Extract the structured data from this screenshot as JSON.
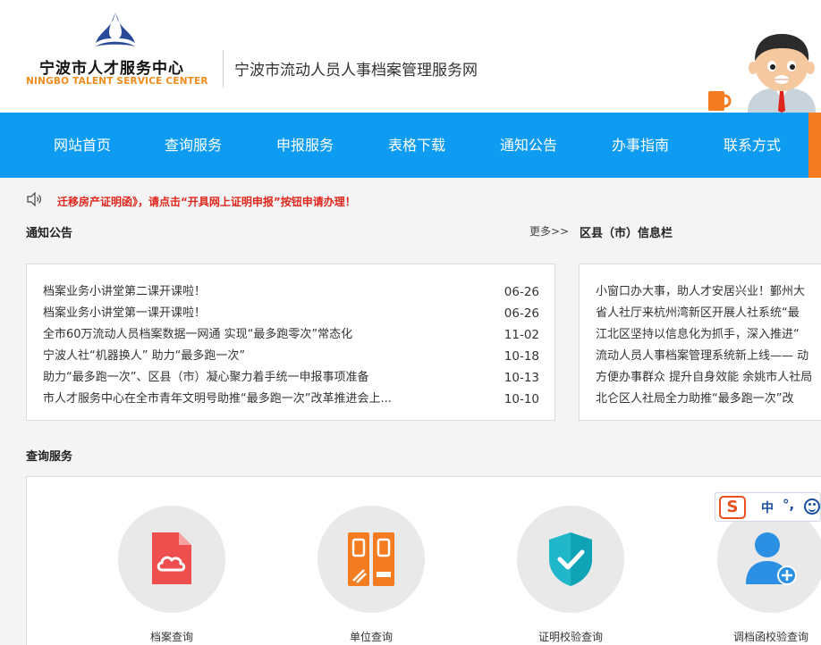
{
  "header": {
    "logo_cn": "宁波市人才服务中心",
    "logo_en": "NINGBO TALENT SERVICE CENTER",
    "site_title": "宁波市流动人员人事档案管理服务网",
    "logo_icon": "tri-arc-logo-icon",
    "mascot_icon": "cartoon-man-mascot"
  },
  "nav": {
    "items": [
      {
        "label": "网站首页"
      },
      {
        "label": "查询服务"
      },
      {
        "label": "申报服务"
      },
      {
        "label": "表格下载"
      },
      {
        "label": "通知公告"
      },
      {
        "label": "办事指南"
      },
      {
        "label": "联系方式"
      }
    ]
  },
  "marquee": {
    "icon": "speaker-icon",
    "text": "迁移房产证明函》，请点击“开具网上证明申报”按钮申请办理！"
  },
  "notices": {
    "title": "通知公告",
    "more": "更多>>",
    "items": [
      {
        "title": "档案业务小讲堂第二课开课啦！",
        "date": "06-26"
      },
      {
        "title": "档案业务小讲堂第一课开课啦！",
        "date": "06-26"
      },
      {
        "title": "全市60万流动人员档案数据一网通 实现“最多跑零次”常态化",
        "date": "11-02"
      },
      {
        "title": "宁波人社“机器换人” 助力“最多跑一次”",
        "date": "10-18"
      },
      {
        "title": "助力“最多跑一次”、区县（市）凝心聚力着手统一申报事项准备",
        "date": "10-13"
      },
      {
        "title": "市人才服务中心在全市青年文明号助推“最多跑一次”改革推进会上...",
        "date": "10-10"
      }
    ]
  },
  "county": {
    "title": "区县（市）信息栏",
    "items": [
      {
        "title": "小窗口办大事，助人才安居兴业！鄞州大"
      },
      {
        "title": "省人社厅来杭州湾新区开展人社系统“最"
      },
      {
        "title": "江北区坚持以信息化为抓手，深入推进“"
      },
      {
        "title": "流动人员人事档案管理系统新上线—— 动"
      },
      {
        "title": "方便办事群众 提升自身效能 余姚市人社局"
      },
      {
        "title": "北仑区人社局全力助推“最多跑一次”改"
      }
    ]
  },
  "services": {
    "title": "查询服务",
    "items": [
      {
        "label": "档案查询",
        "icon": "cloud-document-icon",
        "color": "#ee4e4e"
      },
      {
        "label": "单位查询",
        "icon": "binder-folders-icon",
        "color": "#f47b20"
      },
      {
        "label": "证明校验查询",
        "icon": "shield-check-icon",
        "color": "#1fb7c9"
      },
      {
        "label": "调档函校验查询",
        "icon": "user-add-icon",
        "color": "#2b8fe3"
      }
    ]
  },
  "ime": {
    "logo": "S",
    "lang": "中",
    "punct": "°,",
    "face_icon": "smiley-icon"
  },
  "colors": {
    "nav_bg": "#0d9cf1",
    "accent_orange": "#f47b20",
    "marquee_red": "#e0261c"
  }
}
